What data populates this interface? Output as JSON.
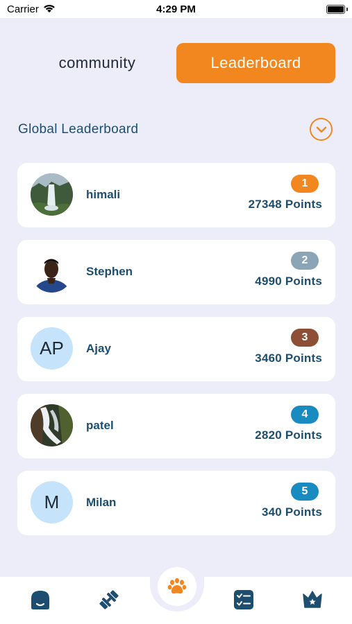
{
  "status_bar": {
    "carrier": "Carrier",
    "time": "4:29 PM"
  },
  "tabs": [
    {
      "label": "community",
      "active": false
    },
    {
      "label": "Leaderboard",
      "active": true
    }
  ],
  "section": {
    "title": "Global Leaderboard"
  },
  "leaderboard": [
    {
      "name": "himali",
      "rank": "1",
      "points": "27348 Points",
      "avatar_type": "photo-waterfall",
      "badge_color": "#F28720"
    },
    {
      "name": "Stephen",
      "rank": "2",
      "points": "4990 Points",
      "avatar_type": "photo-person",
      "badge_color": "#8CA5B6"
    },
    {
      "name": "Ajay",
      "rank": "3",
      "points": "3460 Points",
      "avatar_type": "initials",
      "initials": "AP",
      "badge_color": "#8D5036"
    },
    {
      "name": "patel",
      "rank": "4",
      "points": "2820 Points",
      "avatar_type": "photo-cascade",
      "badge_color": "#1A8BC1"
    },
    {
      "name": "Milan",
      "rank": "5",
      "points": "340 Points",
      "avatar_type": "initials",
      "initials": "M",
      "badge_color": "#1A8BC1"
    }
  ],
  "bottom_nav": {
    "items": [
      "home-icon",
      "fitness-icon",
      "paw-icon",
      "checklist-icon",
      "crown-icon"
    ],
    "active": "paw-icon"
  },
  "colors": {
    "accent": "#F28720",
    "primary_text": "#1D4E6F",
    "icon": "#1D4E6F",
    "background": "#ECEDF8"
  }
}
